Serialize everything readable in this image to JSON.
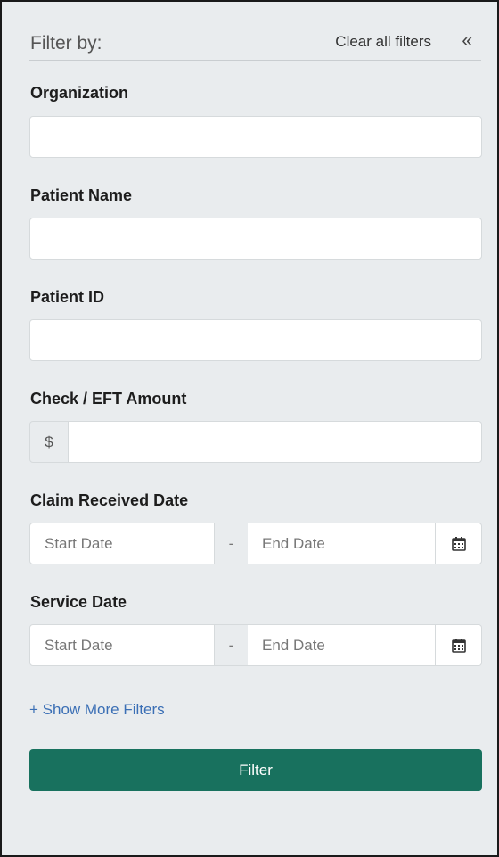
{
  "header": {
    "title": "Filter by:",
    "clear_label": "Clear all filters",
    "collapse_glyph": "«"
  },
  "fields": {
    "organization": {
      "label": "Organization",
      "value": ""
    },
    "patient_name": {
      "label": "Patient Name",
      "value": ""
    },
    "patient_id": {
      "label": "Patient ID",
      "value": ""
    },
    "amount": {
      "label": "Check / EFT Amount",
      "prefix": "$",
      "value": ""
    },
    "claim_received": {
      "label": "Claim Received Date",
      "start_placeholder": "Start Date",
      "separator": "-",
      "end_placeholder": "End Date"
    },
    "service_date": {
      "label": "Service Date",
      "start_placeholder": "Start Date",
      "separator": "-",
      "end_placeholder": "End Date"
    }
  },
  "show_more_label": "+ Show More Filters",
  "filter_button_label": "Filter",
  "icons": {
    "calendar": "calendar-icon",
    "collapse": "double-chevron-left-icon"
  },
  "colors": {
    "primary": "#18715e",
    "link": "#3b6fb5",
    "panel_bg": "#e9ecee"
  }
}
